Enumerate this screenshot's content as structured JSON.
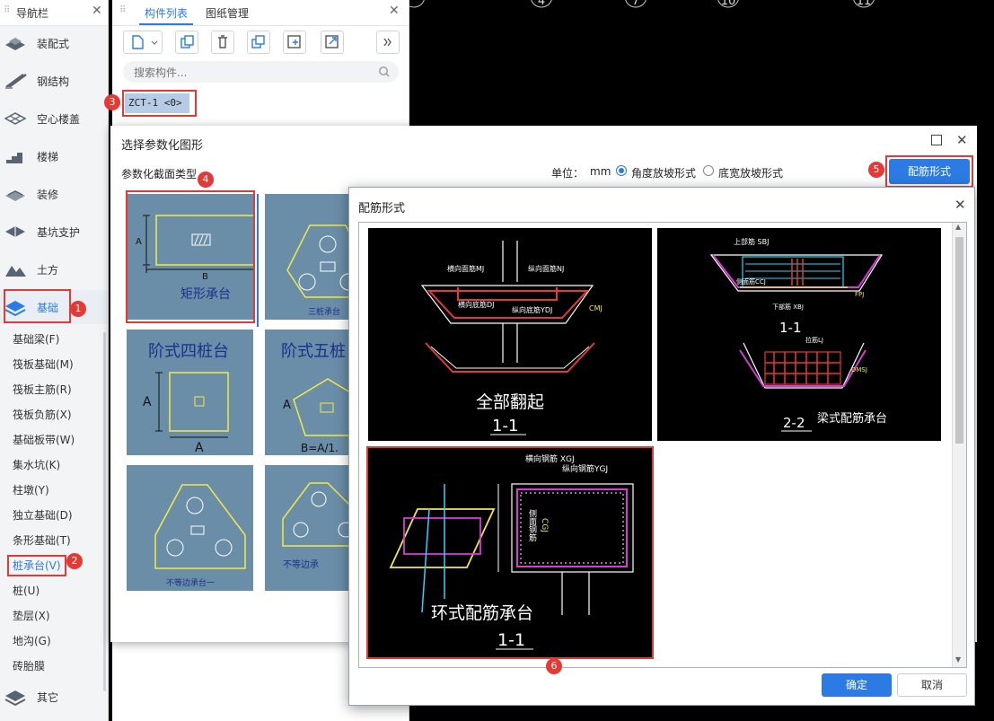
{
  "canvas": {
    "axis_labels": [
      "4",
      "7",
      "10",
      "11"
    ]
  },
  "nav": {
    "title": "导航栏",
    "categories": [
      "装配式",
      "钢结构",
      "空心楼盖",
      "楼梯",
      "装修",
      "基坑支护",
      "土方",
      "基础",
      "其它"
    ],
    "sub_items": [
      "基础梁(F)",
      "筏板基础(M)",
      "筏板主筋(R)",
      "筏板负筋(X)",
      "基础板带(W)",
      "集水坑(K)",
      "柱墩(Y)",
      "独立基础(D)",
      "条形基础(T)",
      "桩承台(V)",
      "桩(U)",
      "垫层(X)",
      "地沟(G)",
      "砖胎膜"
    ]
  },
  "components": {
    "tabs": [
      "构件列表",
      "图纸管理"
    ],
    "search_placeholder": "搜索构件...",
    "item": "ZCT-1 <0>"
  },
  "badges": [
    "1",
    "2",
    "3",
    "4",
    "5",
    "6"
  ],
  "dialog_shape": {
    "title": "选择参数化图形",
    "section_label": "参数化截面类型",
    "unit_label": "单位：",
    "unit_value": "mm",
    "radio_angle": "角度放坡形式",
    "radio_width": "底宽放坡形式",
    "rebar_button": "配筋形式",
    "shapes": [
      {
        "name": "矩形承台",
        "dim_a": "A",
        "dim_b": "B"
      },
      {
        "name": "三桩承台",
        "dim_a": "",
        "dim_b": ""
      },
      {
        "name": "阶式四桩台",
        "dim_a": "A",
        "dim_b": "A"
      },
      {
        "name": "阶式五桩",
        "dim_a": "A",
        "dim_b": "B=A/1."
      },
      {
        "name": "不等边承台一",
        "dim_a": "",
        "dim_b": ""
      },
      {
        "name": "不等边承",
        "dim_a": "",
        "dim_b": ""
      }
    ]
  },
  "dialog_rebar": {
    "title": "配筋形式",
    "ok": "确定",
    "cancel": "取消",
    "options": [
      {
        "title": "全部翻起",
        "section": "1-1",
        "labels": [
          "横向面筋MJ",
          "纵向面筋NJ",
          "横向底筋DJ",
          "纵向底筋YDJ",
          "CMJ"
        ]
      },
      {
        "title": "梁式配筋承台",
        "section": "2-2",
        "section_top": "1-1",
        "labels": [
          "上部筋 SBJ",
          "侧面筋CCJ",
          "下部筋 XBJ",
          "拉筋LJ",
          "FPJ",
          "DMSJ"
        ]
      },
      {
        "title": "环式配筋承台",
        "section": "1-1",
        "labels": [
          "横向钢筋 XGJ",
          "纵向钢筋YGJ",
          "侧面钢筋",
          "CGJ"
        ]
      }
    ]
  },
  "colors": {
    "accent": "#2c7be5",
    "badge": "#e53935",
    "thumb_bg": "#6b8ea8",
    "thumb_line": "#f2e84a",
    "thumb_text": "#1d2f8a"
  }
}
